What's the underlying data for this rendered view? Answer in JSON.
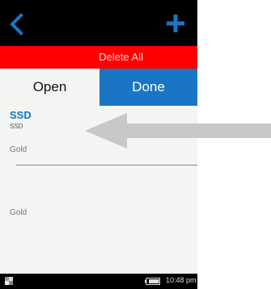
{
  "toolbar": {
    "back_icon": "chevron-left-icon",
    "add_icon": "plus-icon",
    "accent": "#1a75c4"
  },
  "delete_bar": {
    "label": "Delete All",
    "color": "#ff0000"
  },
  "tabs": [
    {
      "label": "Open",
      "active": true
    },
    {
      "label": "Done",
      "active": false
    }
  ],
  "list": {
    "item": {
      "title": "SSD",
      "subtitle": "SSD",
      "gold_label_1": "Gold"
    },
    "gold_label_2": "Gold"
  },
  "status": {
    "time": "10:48 pm",
    "battery_icon": "battery-icon"
  },
  "overlay": {
    "arrow_icon": "arrow-left-icon",
    "arrow_color": "#c8c8c8"
  }
}
